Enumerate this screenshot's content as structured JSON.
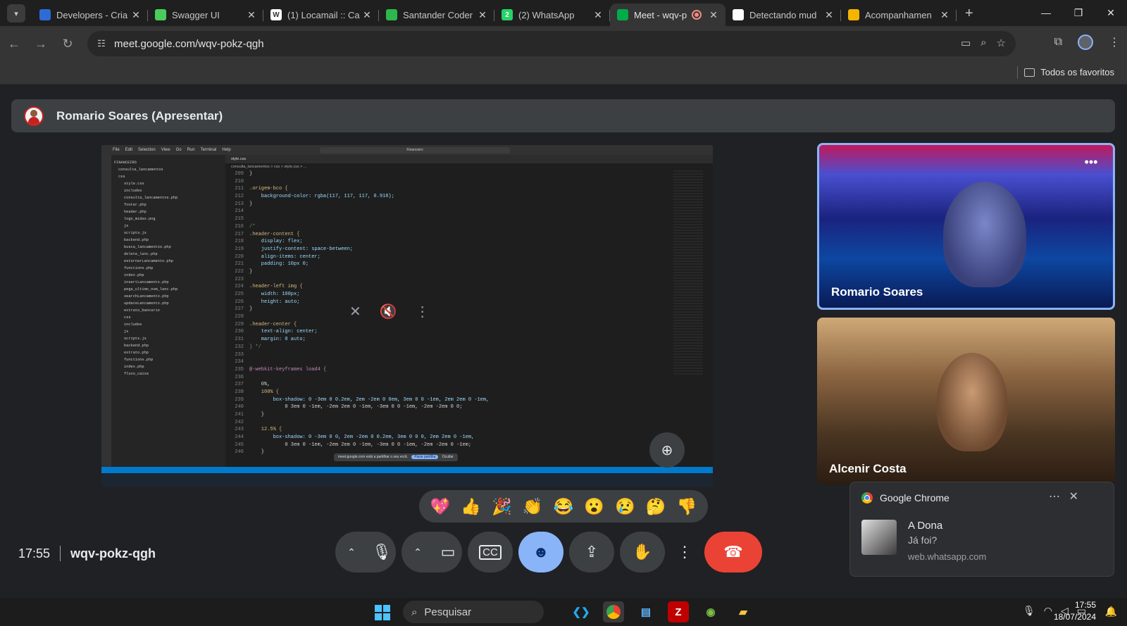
{
  "browser": {
    "tabs": [
      {
        "title": "Developers - Cria",
        "icon": "developers-icon",
        "color": "#2f6bd6",
        "glyph": "",
        "active": false
      },
      {
        "title": "Swagger UI",
        "icon": "swagger-icon",
        "color": "#49cc5c",
        "glyph": "",
        "active": false
      },
      {
        "title": "(1) Locamail :: Ca",
        "icon": "locamail-icon",
        "color": "#ffffff",
        "glyph": "W",
        "active": false
      },
      {
        "title": "Santander Coder",
        "icon": "santander-icon",
        "color": "#2db84d",
        "glyph": "",
        "active": false
      },
      {
        "title": "(2) WhatsApp",
        "icon": "whatsapp-icon",
        "color": "#25d366",
        "glyph": "2",
        "active": false
      },
      {
        "title": "Meet - wqv-p",
        "icon": "google-meet-icon",
        "color": "#00ac47",
        "glyph": "",
        "active": true
      },
      {
        "title": "Detectando mud",
        "icon": "openai-icon",
        "color": "#ffffff",
        "glyph": "",
        "active": false
      },
      {
        "title": "Acompanhamen",
        "icon": "crown-icon",
        "color": "#f4b400",
        "glyph": "",
        "active": false
      }
    ],
    "url": "meet.google.com/wqv-pokz-qgh",
    "bookmark_all": "Todos os favoritos"
  },
  "meet": {
    "presenter_label": "Romario Soares (Apresentar)",
    "participants": [
      {
        "name": "Romario Soares"
      },
      {
        "name": "Alcenir Costa"
      }
    ],
    "reactions": [
      "💖",
      "👍",
      "🎉",
      "👏",
      "😂",
      "😮",
      "😢",
      "🤔",
      "👎"
    ],
    "time": "17:55",
    "meeting_code": "wqv-pokz-qgh"
  },
  "shared_screen": {
    "search": "Financeiro",
    "tab": "style.css",
    "breadcrumb": "consulta_lancamentos > css > style.css > ...",
    "files": [
      "FINANCEIRO",
      "consulta_lancamentos",
      "css",
      "style.css",
      "includes",
      "consulta_lancamentos.php",
      "footer.php",
      "header.php",
      "logo_midas.png",
      "js",
      "scripts.js",
      "backend.php",
      "busca_lancamentos.php",
      "delete_lanc.php",
      "estornarLancamento.php",
      "functions.php",
      "index.php",
      "insertLancamento.php",
      "pega_ultimo_num_lanc.php",
      "searchLancamento.php",
      "updateLancamento.php",
      "extrato_bancario",
      "css",
      "includes",
      "js",
      "scripts.js",
      "backend.php",
      "extrato.php",
      "functions.php",
      "index.php",
      "fluxo_caixa"
    ],
    "code": [
      {
        "n": "209",
        "t": "}"
      },
      {
        "n": "210",
        "t": ""
      },
      {
        "n": "211",
        "t": ".origem-bco {"
      },
      {
        "n": "212",
        "t": "    background-color: rgba(117, 117, 117, 0.918);"
      },
      {
        "n": "213",
        "t": "}"
      },
      {
        "n": "214",
        "t": ""
      },
      {
        "n": "215",
        "t": ""
      },
      {
        "n": "216",
        "t": "/*"
      },
      {
        "n": "217",
        "t": ".header-content {"
      },
      {
        "n": "218",
        "t": "    display: flex;"
      },
      {
        "n": "219",
        "t": "    justify-content: space-between;"
      },
      {
        "n": "220",
        "t": "    align-items: center;"
      },
      {
        "n": "221",
        "t": "    padding: 10px 0;"
      },
      {
        "n": "222",
        "t": "}"
      },
      {
        "n": "223",
        "t": ""
      },
      {
        "n": "224",
        "t": ".header-left img {"
      },
      {
        "n": "225",
        "t": "    width: 100px;"
      },
      {
        "n": "226",
        "t": "    height: auto;"
      },
      {
        "n": "227",
        "t": "}"
      },
      {
        "n": "228",
        "t": ""
      },
      {
        "n": "229",
        "t": ".header-center {"
      },
      {
        "n": "230",
        "t": "    text-align: center;"
      },
      {
        "n": "231",
        "t": "    margin: 0 auto;"
      },
      {
        "n": "232",
        "t": "} */"
      },
      {
        "n": "233",
        "t": ""
      },
      {
        "n": "234",
        "t": ""
      },
      {
        "n": "235",
        "t": "@-webkit-keyframes load4 {"
      },
      {
        "n": "236",
        "t": ""
      },
      {
        "n": "237",
        "t": "    0%,"
      },
      {
        "n": "238",
        "t": "    100% {"
      },
      {
        "n": "239",
        "t": "        box-shadow: 0 -3em 0 0.2em, 2em -2em 0 0em, 3em 0 0 -1em, 2em 2em 0 -1em,"
      },
      {
        "n": "240",
        "t": "            0 3em 0 -1em, -2em 2em 0 -1em, -3em 0 0 -1em, -2em -2em 0 0;"
      },
      {
        "n": "241",
        "t": "    }"
      },
      {
        "n": "242",
        "t": ""
      },
      {
        "n": "243",
        "t": "    12.5% {"
      },
      {
        "n": "244",
        "t": "        box-shadow: 0 -3em 0 0, 2em -2em 0 0.2em, 3em 0 0 0, 2em 2em 0 -1em,"
      },
      {
        "n": "245",
        "t": "            0 3em 0 -1em, -2em 2em 0 -1em, -3em 0 0 -1em, -2em -2em 0 -1em;"
      },
      {
        "n": "246",
        "t": "    }"
      }
    ],
    "share_banner": "meet.google.com está a partilhar o seu ecrã.",
    "share_stop": "Parar partilha",
    "share_hide": "Ocultar"
  },
  "notification": {
    "app": "Google Chrome",
    "title": "A Dona",
    "body": "Já foi?",
    "source": "web.whatsapp.com"
  },
  "taskbar": {
    "search_placeholder": "Pesquisar",
    "time": "17:55",
    "date": "18/07/2024"
  }
}
